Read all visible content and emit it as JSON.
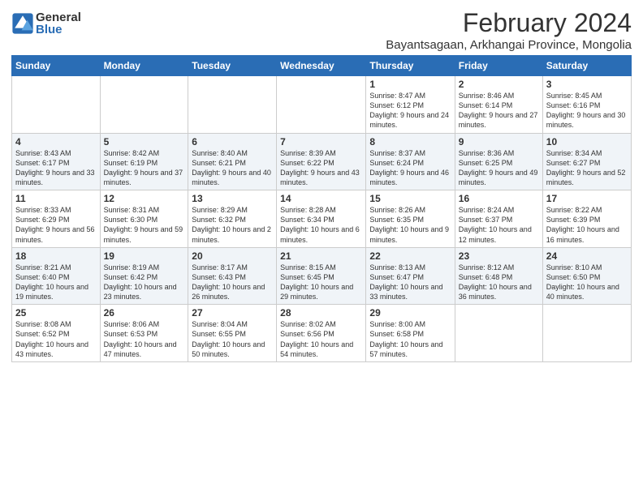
{
  "logo": {
    "general": "General",
    "blue": "Blue"
  },
  "title": "February 2024",
  "location": "Bayantsagaan, Arkhangai Province, Mongolia",
  "days_of_week": [
    "Sunday",
    "Monday",
    "Tuesday",
    "Wednesday",
    "Thursday",
    "Friday",
    "Saturday"
  ],
  "weeks": [
    [
      {
        "day": "",
        "info": ""
      },
      {
        "day": "",
        "info": ""
      },
      {
        "day": "",
        "info": ""
      },
      {
        "day": "",
        "info": ""
      },
      {
        "day": "1",
        "info": "Sunrise: 8:47 AM\nSunset: 6:12 PM\nDaylight: 9 hours\nand 24 minutes."
      },
      {
        "day": "2",
        "info": "Sunrise: 8:46 AM\nSunset: 6:14 PM\nDaylight: 9 hours\nand 27 minutes."
      },
      {
        "day": "3",
        "info": "Sunrise: 8:45 AM\nSunset: 6:16 PM\nDaylight: 9 hours\nand 30 minutes."
      }
    ],
    [
      {
        "day": "4",
        "info": "Sunrise: 8:43 AM\nSunset: 6:17 PM\nDaylight: 9 hours\nand 33 minutes."
      },
      {
        "day": "5",
        "info": "Sunrise: 8:42 AM\nSunset: 6:19 PM\nDaylight: 9 hours\nand 37 minutes."
      },
      {
        "day": "6",
        "info": "Sunrise: 8:40 AM\nSunset: 6:21 PM\nDaylight: 9 hours\nand 40 minutes."
      },
      {
        "day": "7",
        "info": "Sunrise: 8:39 AM\nSunset: 6:22 PM\nDaylight: 9 hours\nand 43 minutes."
      },
      {
        "day": "8",
        "info": "Sunrise: 8:37 AM\nSunset: 6:24 PM\nDaylight: 9 hours\nand 46 minutes."
      },
      {
        "day": "9",
        "info": "Sunrise: 8:36 AM\nSunset: 6:25 PM\nDaylight: 9 hours\nand 49 minutes."
      },
      {
        "day": "10",
        "info": "Sunrise: 8:34 AM\nSunset: 6:27 PM\nDaylight: 9 hours\nand 52 minutes."
      }
    ],
    [
      {
        "day": "11",
        "info": "Sunrise: 8:33 AM\nSunset: 6:29 PM\nDaylight: 9 hours\nand 56 minutes."
      },
      {
        "day": "12",
        "info": "Sunrise: 8:31 AM\nSunset: 6:30 PM\nDaylight: 9 hours\nand 59 minutes."
      },
      {
        "day": "13",
        "info": "Sunrise: 8:29 AM\nSunset: 6:32 PM\nDaylight: 10 hours\nand 2 minutes."
      },
      {
        "day": "14",
        "info": "Sunrise: 8:28 AM\nSunset: 6:34 PM\nDaylight: 10 hours\nand 6 minutes."
      },
      {
        "day": "15",
        "info": "Sunrise: 8:26 AM\nSunset: 6:35 PM\nDaylight: 10 hours\nand 9 minutes."
      },
      {
        "day": "16",
        "info": "Sunrise: 8:24 AM\nSunset: 6:37 PM\nDaylight: 10 hours\nand 12 minutes."
      },
      {
        "day": "17",
        "info": "Sunrise: 8:22 AM\nSunset: 6:39 PM\nDaylight: 10 hours\nand 16 minutes."
      }
    ],
    [
      {
        "day": "18",
        "info": "Sunrise: 8:21 AM\nSunset: 6:40 PM\nDaylight: 10 hours\nand 19 minutes."
      },
      {
        "day": "19",
        "info": "Sunrise: 8:19 AM\nSunset: 6:42 PM\nDaylight: 10 hours\nand 23 minutes."
      },
      {
        "day": "20",
        "info": "Sunrise: 8:17 AM\nSunset: 6:43 PM\nDaylight: 10 hours\nand 26 minutes."
      },
      {
        "day": "21",
        "info": "Sunrise: 8:15 AM\nSunset: 6:45 PM\nDaylight: 10 hours\nand 29 minutes."
      },
      {
        "day": "22",
        "info": "Sunrise: 8:13 AM\nSunset: 6:47 PM\nDaylight: 10 hours\nand 33 minutes."
      },
      {
        "day": "23",
        "info": "Sunrise: 8:12 AM\nSunset: 6:48 PM\nDaylight: 10 hours\nand 36 minutes."
      },
      {
        "day": "24",
        "info": "Sunrise: 8:10 AM\nSunset: 6:50 PM\nDaylight: 10 hours\nand 40 minutes."
      }
    ],
    [
      {
        "day": "25",
        "info": "Sunrise: 8:08 AM\nSunset: 6:52 PM\nDaylight: 10 hours\nand 43 minutes."
      },
      {
        "day": "26",
        "info": "Sunrise: 8:06 AM\nSunset: 6:53 PM\nDaylight: 10 hours\nand 47 minutes."
      },
      {
        "day": "27",
        "info": "Sunrise: 8:04 AM\nSunset: 6:55 PM\nDaylight: 10 hours\nand 50 minutes."
      },
      {
        "day": "28",
        "info": "Sunrise: 8:02 AM\nSunset: 6:56 PM\nDaylight: 10 hours\nand 54 minutes."
      },
      {
        "day": "29",
        "info": "Sunrise: 8:00 AM\nSunset: 6:58 PM\nDaylight: 10 hours\nand 57 minutes."
      },
      {
        "day": "",
        "info": ""
      },
      {
        "day": "",
        "info": ""
      }
    ]
  ]
}
